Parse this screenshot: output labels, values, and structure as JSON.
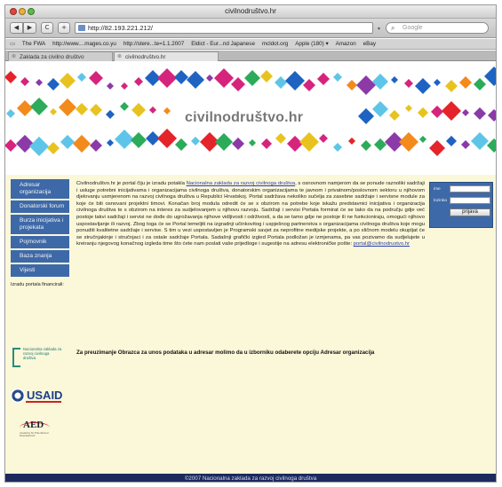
{
  "window": {
    "title": "civilnodruštvo.hr"
  },
  "toolbar": {
    "back_icon": "back-arrow-icon",
    "forward_icon": "forward-arrow-icon",
    "reload_label": "C",
    "add_label": "+",
    "url": "http://82.193.221.212/",
    "search_placeholder": "Google"
  },
  "bookmarks": [
    "The FWA",
    "http://www....mages.co.yu",
    "http://stere...te=1.1.2007",
    "Eldict - Eur...nd Japanese",
    "mcldot.org",
    "Apple (180) ▾",
    "Amazon",
    "eBay"
  ],
  "tabs": [
    {
      "label": "Zaklada za civilno društvo"
    },
    {
      "label": "civilnodruštvo.hr"
    }
  ],
  "page": {
    "site_title": "civilnodruštvo.hr",
    "nav": [
      "Adresar organizacija",
      "Donatorski forum",
      "Burza inicijativa i projekata",
      "Pojmovnik",
      "Baza znanja",
      "Vijesti"
    ],
    "financing_label": "Izradu portala financirali:",
    "logos": {
      "nz_text": "Nacionalna zaklada za razvoj civilnoga društva",
      "usaid_text": "USAID",
      "aed_text": "AED",
      "aed_sub": "Academy for Educational Development"
    },
    "intro_start": "Civilnodruštvo.hr je portal čiju je izradu potakla ",
    "intro_link": "Nacionalna zaklada za razvoj civilnoga društva",
    "intro_body": ", s osnovnom namjerom da se ponude raznoliki sadržaji i usluge potrebni inicijativama i organizacijama civilnoga društva, donatorskim organizacijama te javnom i privatnom/poslovnom sektoru u njihovom djelovanju usmjerenom na razvoj civilnoga društva u Republici Hrvatskoj. Portal sadržava nekoliko sučelja za zasebne sadržaje i servisne module za koje će biti osnovani projektni timovi. Konačan broj modula odredit će se s obzirom na potrebe koje iskažu predstavnici inicijativa i organizacija civilnoga društva te s obzirom na interes za sudjelovanjem u njihovu razvoju. Sadržaji i servisi Portala formirat će se tako da na području gdje već postoje takvi sadržaji i servisi ne dođe do ugrožavanja njihove vidljivosti i održivosti, a da se tamo gdje ne postoje ili ne funkcioniraju, omogući njihovo uspostavljanje ili razvoj. Zbog toga će se Portal temeljiti na izgradnji učinkovitog i uspješnog partnerstva s organizacijama civilnoga društva koje mogu ponuditi kvalitetne sadržaje i servise. S tim u vezi uspostavljen je Programski savjet za neprofitne medijske projekte, a po sličnom modelu okupljat će se stručnjakinje i stručnjaci i za ostale sadržaje Portala. Sadašnji grafički izgled Portala podložan je izmjenama, pa vas pozivamo da sudjelujete u kreiranju njegovog konačnog izgleda time što ćete nam poslati vaše prijedloge i sugestije na adresu elektroničke pošte: ",
    "intro_email": "portal@civilnodrustvo.hr",
    "notice": "Za preuzimanje Obrazca za unos podataka u adresar molimo da u izborniku odaberete opciju Adresar organizacija",
    "login": {
      "user_label": "ime",
      "pass_label": "lozinka",
      "button_label": "prijava"
    },
    "footer": "©2007 Nacionalna zaklada za razvoj civilnoga društva"
  },
  "colors": {
    "nav_blue": "#3e69a8",
    "content_bg": "#fbf7d9",
    "footer_bg": "#1c2a5e",
    "banner_palette": [
      "#e8c31f",
      "#2cab5a",
      "#1e63c2",
      "#d6247d",
      "#e4232b",
      "#5fc5e8",
      "#f28a1c",
      "#8b3aa8"
    ]
  }
}
